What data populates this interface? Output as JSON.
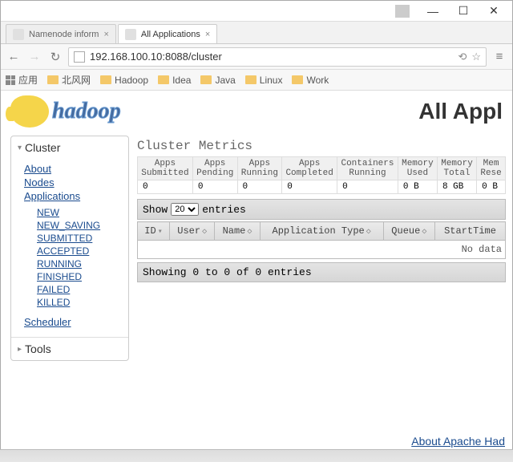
{
  "window": {
    "minimize": "—",
    "maximize": "☐",
    "close": "✕"
  },
  "tabs": [
    {
      "label": "Namenode inform",
      "active": false
    },
    {
      "label": "All Applications",
      "active": true
    }
  ],
  "nav": {
    "back": "←",
    "forward": "→",
    "reload": "↻",
    "url": "192.168.100.10:8088/cluster",
    "translate": "⟲",
    "star": "☆"
  },
  "bookmarks": [
    {
      "label": "应用",
      "type": "apps"
    },
    {
      "label": "北风网"
    },
    {
      "label": "Hadoop"
    },
    {
      "label": "Idea"
    },
    {
      "label": "Java"
    },
    {
      "label": "Linux"
    },
    {
      "label": "Work"
    }
  ],
  "logo_text": "hadoop",
  "page_title": "All Appl",
  "sidebar": {
    "cluster": {
      "title": "Cluster",
      "about": "About",
      "nodes": "Nodes",
      "applications": "Applications",
      "states": [
        "NEW",
        "NEW_SAVING",
        "SUBMITTED",
        "ACCEPTED",
        "RUNNING",
        "FINISHED",
        "FAILED",
        "KILLED"
      ],
      "scheduler": "Scheduler"
    },
    "tools": {
      "title": "Tools"
    }
  },
  "metrics": {
    "title": "Cluster Metrics",
    "headers": [
      "Apps Submitted",
      "Apps Pending",
      "Apps Running",
      "Apps Completed",
      "Containers Running",
      "Memory Used",
      "Memory Total",
      "Mem Rese"
    ],
    "values": [
      "0",
      "0",
      "0",
      "0",
      "0",
      "0 B",
      "8 GB",
      "0 B"
    ]
  },
  "entries": {
    "show": "Show",
    "count": "20",
    "suffix": "entries",
    "headers": [
      "ID",
      "User",
      "Name",
      "Application Type",
      "Queue",
      "StartTime"
    ],
    "nodata": "No data",
    "showing": "Showing 0 to 0 of 0 entries"
  },
  "footer": "About Apache Had"
}
